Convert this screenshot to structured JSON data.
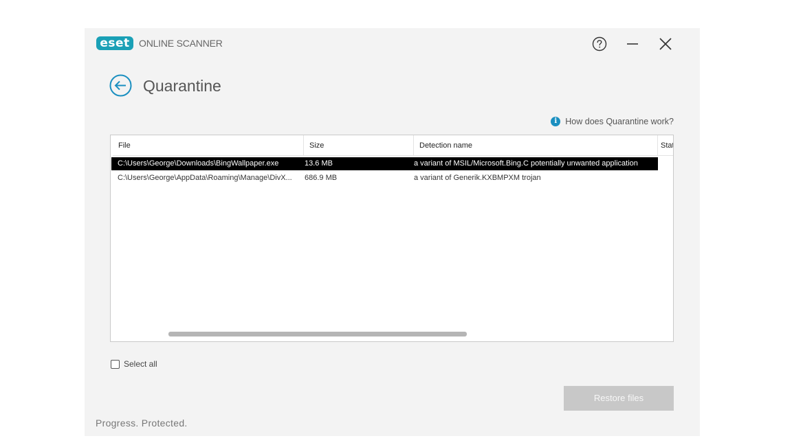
{
  "app": {
    "logo_text": "eset",
    "product_name": "ONLINE SCANNER",
    "brand_color": "#1aa0b6"
  },
  "window_controls": {
    "help_icon": "question-circle-icon",
    "minimize_icon": "minimize-icon",
    "close_icon": "close-icon"
  },
  "page": {
    "title": "Quarantine",
    "back_icon": "arrow-left-circle-icon",
    "help_link": "How does Quarantine work?"
  },
  "table": {
    "columns": [
      "File",
      "Size",
      "Detection name",
      "Stat"
    ],
    "rows": [
      {
        "file": "C:\\Users\\George\\Downloads\\BingWallpaper.exe",
        "size": "13.6 MB",
        "detection": "a variant of MSIL/Microsoft.Bing.C potentially unwanted application",
        "selected": true
      },
      {
        "file": "C:\\Users\\George\\AppData\\Roaming\\Manage\\DivX...",
        "size": "686.9 MB",
        "detection": "a variant of Generik.KXBMPXM trojan",
        "selected": false
      }
    ]
  },
  "select_all_label": "Select all",
  "select_all_checked": false,
  "restore_button": "Restore files",
  "tagline": "Progress. Protected."
}
